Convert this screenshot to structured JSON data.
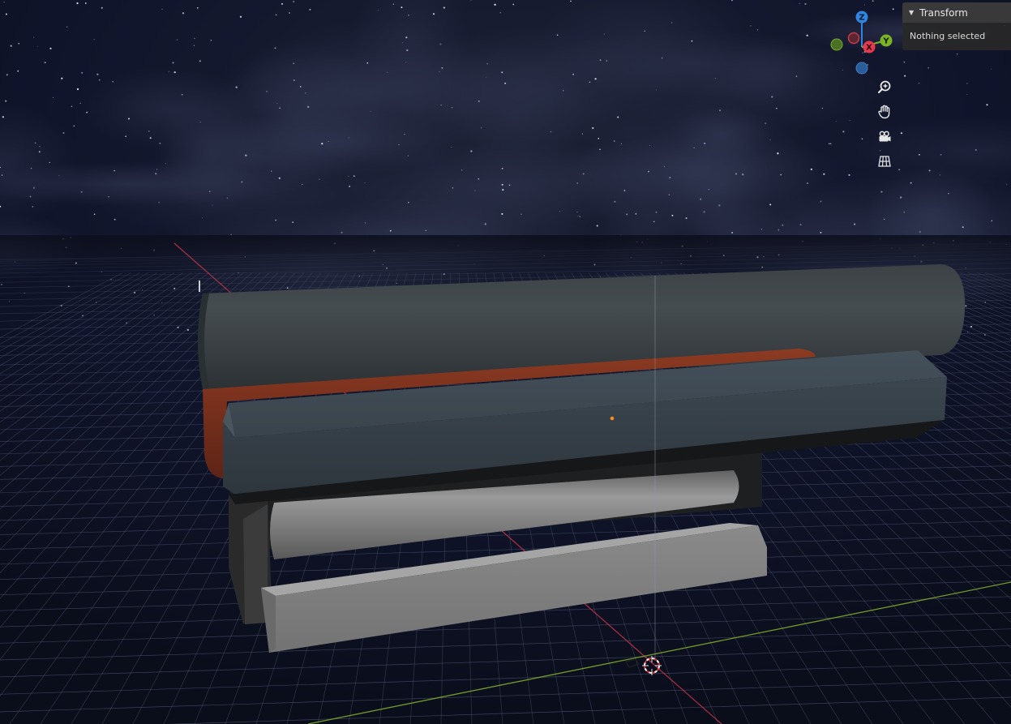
{
  "npanel": {
    "tab_title": "Transform",
    "status_text": "Nothing selected"
  },
  "gizmo": {
    "z_label": "Z",
    "x_label": "X",
    "y_label": "Y",
    "colors": {
      "x": "#e8394f",
      "y": "#7bb327",
      "z": "#2f86e0"
    }
  },
  "nav_tools": [
    {
      "icon": "zoom-icon"
    },
    {
      "icon": "hand-pan-icon"
    },
    {
      "icon": "camera-view-icon"
    },
    {
      "icon": "orthographic-grid-icon"
    }
  ],
  "viewport": {
    "grid_color": "#5b6380",
    "x_axis_color": "#c9364a",
    "y_axis_color": "#7dab2b"
  }
}
